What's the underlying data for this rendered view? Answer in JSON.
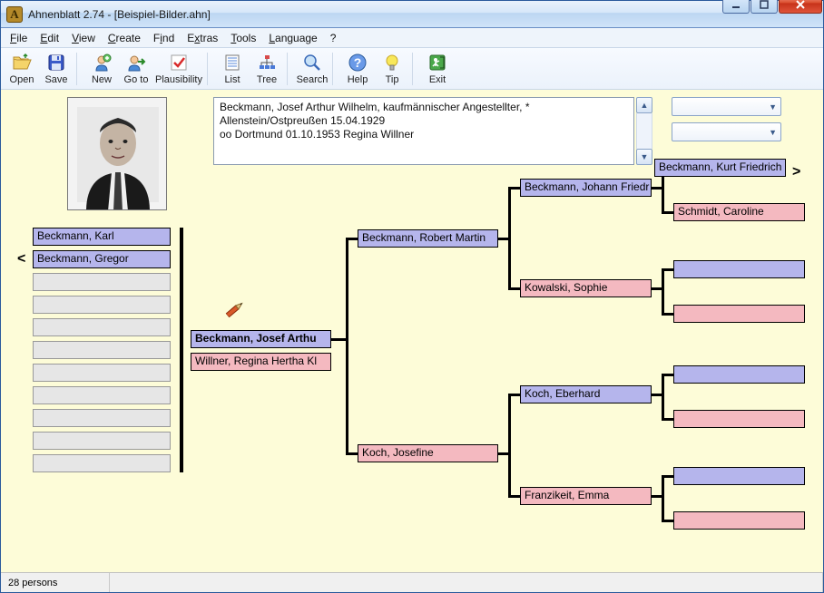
{
  "window": {
    "title": "Ahnenblatt 2.74 - [Beispiel-Bilder.ahn]"
  },
  "menu": {
    "file": "File",
    "edit": "Edit",
    "view": "View",
    "create": "Create",
    "find": "Find",
    "extras": "Extras",
    "tools": "Tools",
    "language": "Language",
    "help": "?"
  },
  "toolbar": {
    "open": "Open",
    "save": "Save",
    "new": "New",
    "goto": "Go to",
    "plausibility": "Plausibility",
    "list": "List",
    "tree": "Tree",
    "search": "Search",
    "help": "Help",
    "tip": "Tip",
    "exit": "Exit"
  },
  "details": {
    "line1": "Beckmann, Josef Arthur Wilhelm, kaufmännischer Angestellter, *",
    "line2": "Allenstein/Ostpreußen 15.04.1929",
    "line3": "oo Dortmund 01.10.1953 Regina Willner"
  },
  "side_list": {
    "item0": "Beckmann, Karl",
    "item1": "Beckmann, Gregor"
  },
  "tree": {
    "focus_person": "Beckmann, Josef Arthu",
    "focus_spouse": "Willner, Regina Hertha Kl",
    "father": "Beckmann, Robert Martin",
    "mother": "Koch, Josefine",
    "gf_p": "Beckmann, Johann Friedr",
    "gm_p": "Kowalski, Sophie",
    "gf_m": "Koch, Eberhard",
    "gm_m": "Franzikeit, Emma",
    "ggf": "Beckmann, Kurt Friedrich",
    "ggm": "Schmidt, Caroline"
  },
  "status": {
    "persons": "28 persons"
  }
}
